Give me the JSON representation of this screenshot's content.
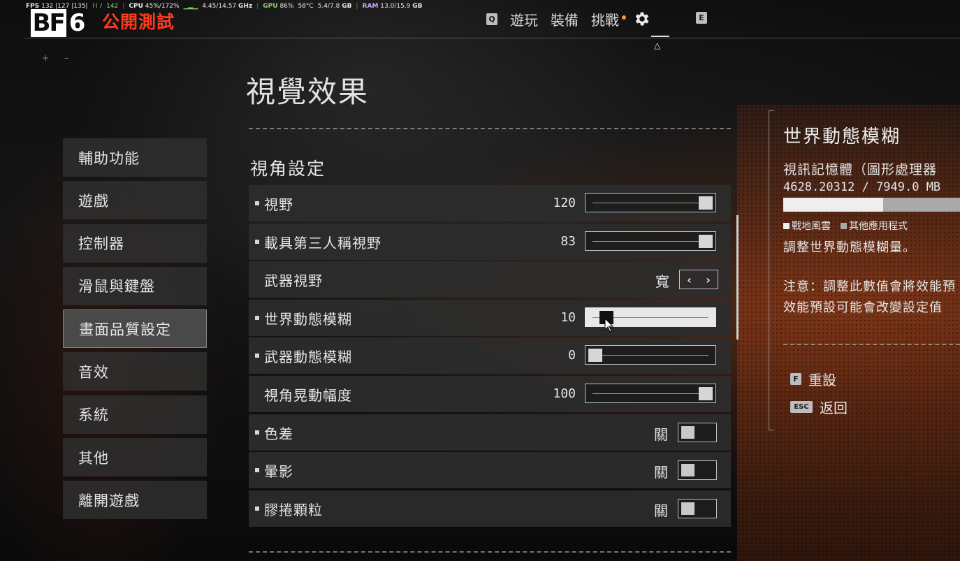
{
  "overlay": {
    "fps_label": "FPS",
    "fps_value": "132 |127 |135|",
    "green_value": "142",
    "cpu_label": "CPU",
    "cpu_value": "45%/172%",
    "clock_value": "4.45/14.57",
    "clock_unit": "GHz",
    "gpu_label": "GPU",
    "gpu_value": "86%",
    "gpu_temp": "58°C",
    "vram_value": "5.4/7.8",
    "vram_unit": "GB",
    "ram_label": "RAM",
    "ram_value": "13.0/15.9",
    "ram_unit": "GB"
  },
  "header": {
    "logo_bf": "BF",
    "logo_six": "6",
    "beta_label": "公開測試",
    "nav_key_left": "Q",
    "nav_key_right": "E",
    "nav_items": [
      "遊玩",
      "裝備",
      "挑戰"
    ],
    "accent_color": "#ff3b1f",
    "notification_color": "#f29a2b"
  },
  "corner_marks": [
    "+",
    "–"
  ],
  "page_title": "視覺效果",
  "sidebar": {
    "items": [
      "輔助功能",
      "遊戲",
      "控制器",
      "滑鼠與鍵盤",
      "畫面品質設定",
      "音效",
      "系統",
      "其他",
      "離開遊戲"
    ],
    "active_index": 4
  },
  "section_title": "視角設定",
  "settings": [
    {
      "label": "視野",
      "value": "120",
      "type": "slider",
      "fraction": 1.0,
      "bullet": true
    },
    {
      "label": "載具第三人稱視野",
      "value": "83",
      "type": "slider",
      "fraction": 1.0,
      "bullet": true
    },
    {
      "label": "武器視野",
      "value": "寬",
      "type": "selector",
      "bullet": false
    },
    {
      "label": "世界動態模糊",
      "value": "10",
      "type": "slider",
      "fraction": 0.1,
      "bullet": true,
      "hover": true
    },
    {
      "label": "武器動態模糊",
      "value": "0",
      "type": "slider",
      "fraction": 0.0,
      "bullet": true
    },
    {
      "label": "視角晃動幅度",
      "value": "100",
      "type": "slider",
      "fraction": 1.0,
      "bullet": false
    },
    {
      "label": "色差",
      "value": "關",
      "type": "toggle",
      "bullet": true
    },
    {
      "label": "暈影",
      "value": "關",
      "type": "toggle",
      "bullet": true
    },
    {
      "label": "膠捲顆粒",
      "value": "關",
      "type": "toggle",
      "bullet": true
    }
  ],
  "info_panel": {
    "title": "世界動態模糊",
    "vram_label": "視訊記憶體（圖形處理器",
    "vram_value": "4628.20312 / 7949.0 MB",
    "vram_bf_fraction": 0.566,
    "vram_other_fraction": 0.434,
    "legend_bf": "戰地風雲",
    "legend_other": "其他應用程式",
    "description": "調整世界動態模糊量。",
    "note_line1": "注意：調整此數值會將效能預",
    "note_line2": "效能預設可能會改變設定值",
    "reset_key": "F",
    "reset_label": "重設",
    "back_key": "ESC",
    "back_label": "返回"
  }
}
